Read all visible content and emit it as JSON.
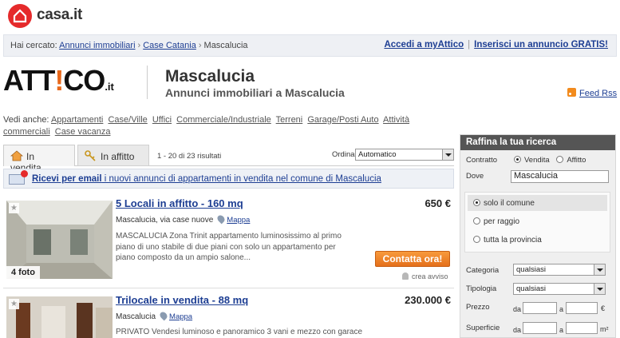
{
  "brand": {
    "logo_text": "casa.it",
    "brand_color": "#e52a2b"
  },
  "breadcrumb": {
    "prefix": "Hai cercato:",
    "items": [
      "Annunci immobiliari",
      "Case Catania",
      "Mascalucia"
    ],
    "sep": "›"
  },
  "top_links": {
    "accedi": "Accedi a myAttico",
    "pipe": "|",
    "inserisci": "Inserisci un annuncio GRATIS!"
  },
  "attico": {
    "part1": "ATT",
    "excl": "!",
    "part2": "CO",
    "suffix": ".it"
  },
  "header": {
    "title": "Mascalucia",
    "subtitle": "Annunci immobiliari a Mascalucia",
    "feed": "Feed Rss"
  },
  "vedi_anche": {
    "label": "Vedi anche:",
    "links": [
      "Appartamenti",
      "Case/Ville",
      "Uffici",
      "Commerciale/Industriale",
      "Terreni",
      "Garage/Posti Auto",
      "Attività commerciali",
      "Case vacanza"
    ]
  },
  "tabs": {
    "vendita": "In vendita",
    "affitto": "In affitto"
  },
  "results": {
    "text": "1 - 20 di 23 risultati",
    "ordina_label": "Ordina",
    "ordina_value": "Automatico"
  },
  "alert": {
    "bold": "Ricevi per email",
    "rest": " i nuovi annunci di appartamenti in vendita nel comune di Mascalucia"
  },
  "listings": [
    {
      "title": "5 Locali in affitto - 160 mq",
      "price": "650 €",
      "address": "Mascalucia, via case nuove",
      "map": "Mappa",
      "desc": "MASCALUCIA Zona Trinit appartamento luminosissimo al primo piano di uno stabile di due piani con solo un appartamento per piano composto da un ampio salone...",
      "photos": "4 foto",
      "contact": "Contatta ora!",
      "alert": "crea avviso"
    },
    {
      "title": "Trilocale in vendita - 88 mq",
      "price": "230.000 €",
      "address": "Mascalucia",
      "map": "Mappa",
      "desc": "PRIVATO Vendesi luminoso e panoramico 3 vani e mezzo con garace"
    }
  ],
  "panel": {
    "title": "Raffina la tua ricerca",
    "contratto_label": "Contratto",
    "vendita": "Vendita",
    "affitto": "Affitto",
    "dove_label": "Dove",
    "dove_value": "Mascalucia",
    "scope": [
      "solo il comune",
      "per raggio",
      "tutta la provincia"
    ],
    "categoria_label": "Categoria",
    "categoria_value": "qualsiasi",
    "tipologia_label": "Tipologia",
    "tipologia_value": "qualsiasi",
    "prezzo_label": "Prezzo",
    "superficie_label": "Superficie",
    "da": "da",
    "a": "a",
    "euro": "€",
    "mq": "m²"
  },
  "colors": {
    "accent_orange": "#e4701b",
    "link_blue": "#1d3e93",
    "panel_head": "#555555"
  }
}
